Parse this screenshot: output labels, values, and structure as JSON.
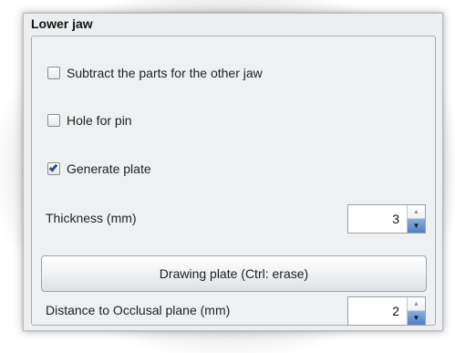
{
  "panel": {
    "title": "Lower jaw"
  },
  "options": {
    "subtract_parts_label": "Subtract the parts for the other jaw",
    "subtract_parts_checked": false,
    "hole_for_pin_label": "Hole for pin",
    "hole_for_pin_checked": false,
    "generate_plate_label": "Generate plate",
    "generate_plate_checked": true
  },
  "thickness": {
    "label": "Thickness (mm)",
    "value": "3"
  },
  "drawing_plate": {
    "label": "Drawing plate (Ctrl: erase)"
  },
  "distance": {
    "label": "Distance to Occlusal plane (mm)",
    "value": "2"
  },
  "icons": {
    "checkbox_checked": "check-icon",
    "spinner_up": "chevron-up-icon",
    "spinner_down": "chevron-down-icon"
  },
  "colors": {
    "panel_bg": "#eceef0",
    "checkmark": "#2f4d8f",
    "spinner_active": "#4f80c6"
  }
}
